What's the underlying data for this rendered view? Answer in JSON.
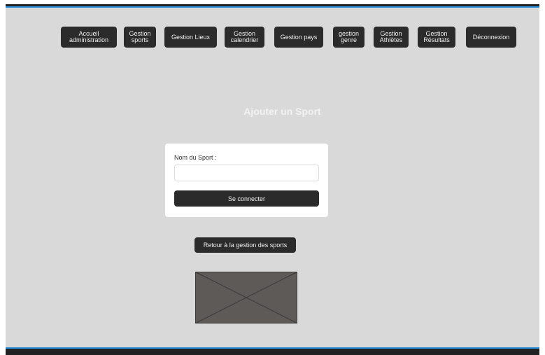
{
  "nav": {
    "items": [
      {
        "label": "Accueil\nadministration"
      },
      {
        "label": "Gestion\nsports"
      },
      {
        "label": "Gestion Lieux"
      },
      {
        "label": "Gestion\ncalendrier"
      },
      {
        "label": "Gestion pays"
      },
      {
        "label": "gestion\ngenre"
      },
      {
        "label": "Gestion\nAthlètes"
      },
      {
        "label": "Gestion\nRésultats"
      },
      {
        "label": "Déconnexion"
      }
    ]
  },
  "main": {
    "title": "Ajouter un Sport",
    "form": {
      "field_label": "Nom du Sport :",
      "field_value": "",
      "submit_label": "Se connecter"
    },
    "back_label": "Retour à la gestion des sports"
  },
  "colors": {
    "background": "#d9d9d9",
    "button": "#2b2b2b",
    "accent": "#2a8bd6",
    "placeholder_fill": "#5e5a58"
  },
  "image": {
    "icon": "image-placeholder-icon"
  }
}
